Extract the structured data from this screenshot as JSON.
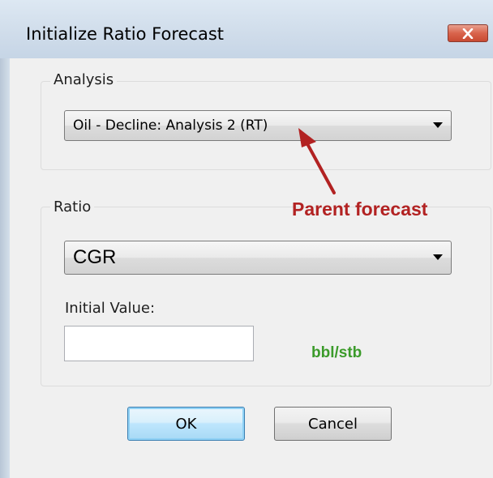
{
  "dialog": {
    "title": "Initialize Ratio Forecast"
  },
  "analysis_group": {
    "label": "Analysis",
    "selected": "Oil - Decline: Analysis 2 (RT)"
  },
  "ratio_group": {
    "label": "Ratio",
    "selected": "CGR",
    "initial_value_label": "Initial Value:",
    "initial_value": "",
    "unit": "bbl/stb"
  },
  "buttons": {
    "ok": "OK",
    "cancel": "Cancel"
  },
  "annotation": {
    "text": "Parent forecast"
  },
  "colors": {
    "annotation": "#b22222",
    "unit": "#3b9b2a",
    "close_button": "#d9644c"
  },
  "icons": {
    "close": "close-x-icon",
    "dropdown": "chevron-down-icon",
    "annotation_arrow": "arrow-icon"
  }
}
